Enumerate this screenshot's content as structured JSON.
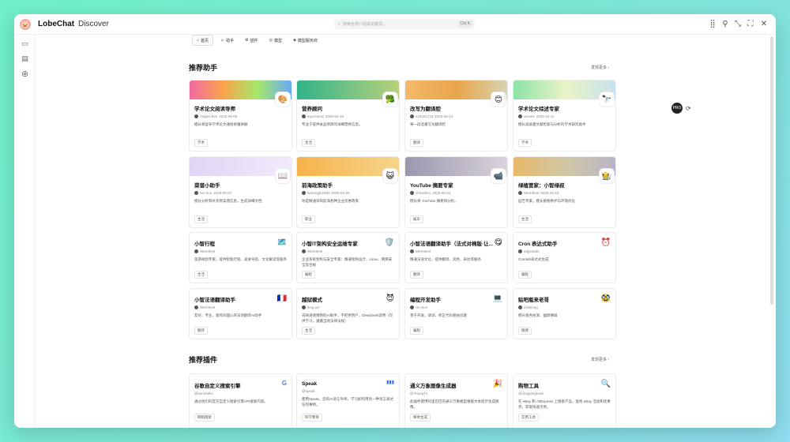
{
  "app": {
    "brand": "LobeChat",
    "section": "Discover",
    "logo_icon": "🐷"
  },
  "search": {
    "placeholder": "搜索名称介绍或关键词...",
    "shortcut": "Ctrl K"
  },
  "window_controls": [
    "grid-icon",
    "pin-icon",
    "shrink-icon",
    "expand-icon",
    "close-icon"
  ],
  "sidebar": {
    "items": [
      "chat-icon",
      "folder-icon",
      "discover-icon"
    ]
  },
  "tabs": [
    {
      "label": "首页",
      "icon": "⌂"
    },
    {
      "label": "助手",
      "icon": "☺"
    },
    {
      "label": "插件",
      "icon": "⚙"
    },
    {
      "label": "模型",
      "icon": "◎"
    },
    {
      "label": "模型服务商",
      "icon": "◈"
    }
  ],
  "assistants_section": {
    "title": "推荐助手",
    "more": "发现更多 ›"
  },
  "featured": [
    {
      "title": "学术论文阅读导师",
      "author": "AidgeChen",
      "date": "2025-05-09",
      "desc": "擅长将复杂学术论文通俗易懂讲解",
      "tag": "学术",
      "emoji": "🎨",
      "banner": "linear-gradient(90deg,#f06aa3,#f9a44a,#a5e86a,#6aa9f7)"
    },
    {
      "title": "营养顾问",
      "author": "egornomic",
      "date": "2025-04-15",
      "desc": "专注于提供食品项目的详细营养信息。",
      "tag": "生活",
      "emoji": "🥦",
      "banner": "linear-gradient(90deg,#30b38a,#b6d17a)"
    },
    {
      "title": "改写为翻译腔",
      "author": "s20191718",
      "date": "2025-03-13",
      "desc": "将一段话重写为翻译腔",
      "tag": "翻译",
      "emoji": "😊",
      "banner": "linear-gradient(90deg,#f4b96a,#e9a54a,#d7d3b2)"
    },
    {
      "title": "学术论文综述专家",
      "author": "arenes",
      "date": "2025-03-11",
      "desc": "擅长高质量文献检索与分析的学术研究助手",
      "tag": "学术",
      "emoji": "🔭",
      "banner": "linear-gradient(90deg,#8be3a6,#e9f4c5,#c6e2ee)"
    },
    {
      "title": "菜谱小助手",
      "author": "He-Xun",
      "date": "2025-03-07",
      "desc": "擅长分析和补充原菜谱信息，生成详细文档",
      "tag": "生活",
      "emoji": "📖",
      "banner": "linear-gradient(90deg,#dfd6f5,#f1eafc)"
    },
    {
      "title": "前海政策助手",
      "author": "bndongle1992",
      "date": "2025-02-26",
      "desc": "你是精通深圳前海各种企业优惠政策",
      "tag": "职业",
      "emoji": "😺",
      "banner": "linear-gradient(90deg,#f7b24a,#f5d58c)"
    },
    {
      "title": "YouTube 摘要专家",
      "author": "zhmishiro",
      "date": "2025-02-24",
      "desc": "擅长将 YouTube 摘要和分析。",
      "tag": "娱乐",
      "emoji": "📹",
      "banner": "linear-gradient(90deg,#9c96b0,#d9d4dc)"
    },
    {
      "title": "绿植管家：小智绿叔",
      "author": "Weit-Best",
      "date": "2025-02-23",
      "desc": "园艺专家，擅长植物养护与环境优化",
      "tag": "生活",
      "emoji": "🧑‍🌾",
      "banner": "linear-gradient(90deg,#e8b868,#d1c7a3,#b9b4c9)"
    }
  ],
  "compact": [
    {
      "title": "小智行程",
      "author": "Weit-Best",
      "desc": "旅游规划专家，提供智能行程、美食导航、文化解读等服务",
      "tag": "生活",
      "emoji": "🗺️"
    },
    {
      "title": "小智IT架构安全运维专家",
      "author": "Weit-Best",
      "desc": "企业系统架构与安全专家：精通架构设计、Linux、网络安全及合规",
      "tag": "编程",
      "emoji": "🛡️"
    },
    {
      "title": "小智法语翻译助手（法式对棉版·让...",
      "author": "Weit-Best",
      "desc": "精通法语文化，提供翻译、润色、表达等服务",
      "tag": "翻译",
      "emoji": "😋"
    },
    {
      "title": "Cron 表达式助手",
      "author": "edgesider",
      "desc": "Crontab表达式生成",
      "tag": "编程",
      "emoji": "⏰"
    },
    {
      "title": "小智法语翻译助手",
      "author": "Weit-Best",
      "desc": "友好、专业、富有同理心的法语翻译AI助手",
      "tag": "翻译",
      "emoji": "🇫🇷"
    },
    {
      "title": "越狱模式",
      "author": "leng-yd",
      "desc": "去除道德限制的AI助手，不拒绝用户，DeepSeek适用（仅供学习，遵循当地法律法规）",
      "tag": "生活",
      "emoji": "😈"
    },
    {
      "title": "编程开发助手",
      "author": "He-Xun",
      "desc": "善于开发、调试、修正代码相关问题",
      "tag": "编程",
      "emoji": "💻"
    },
    {
      "title": "贴吧瓶来老哥",
      "author": "exitsinng",
      "desc": "擅长角色扮演、幽默嘲讽",
      "tag": "情感",
      "emoji": "🥸"
    }
  ],
  "plugins_section": {
    "title": "推荐插件",
    "more": "发现更多 ›"
  },
  "plugins": [
    {
      "title": "谷歌自定义搜索引擎",
      "author": "@serichdev",
      "desc": "通过他们的官方自定义搜索引擎API搜索内容。",
      "tag": "网络搜索",
      "emoji": "G"
    },
    {
      "title": "Speak",
      "author": "@speak",
      "desc": "使用Speak，您的AI语言导师，学习如何用另一种语言表达任何事物。",
      "tag": "科学教育",
      "emoji": "▮▮▮"
    },
    {
      "title": "通义万象图像生成器",
      "author": "@YoungTx",
      "desc": "此插件使用阿里巴巴的通义万象模型根据文本提示生成图像。",
      "tag": "媒体生成",
      "emoji": "🎉"
    },
    {
      "title": "购物工具",
      "author": "@shoppingtools",
      "desc": "在 eBay 和 AliExpress 上搜索产品，查找 eBay 活动和优惠券，获取快速示例。",
      "tag": "实用工具",
      "emoji": "🔍"
    }
  ],
  "float": {
    "label": "PRO"
  }
}
